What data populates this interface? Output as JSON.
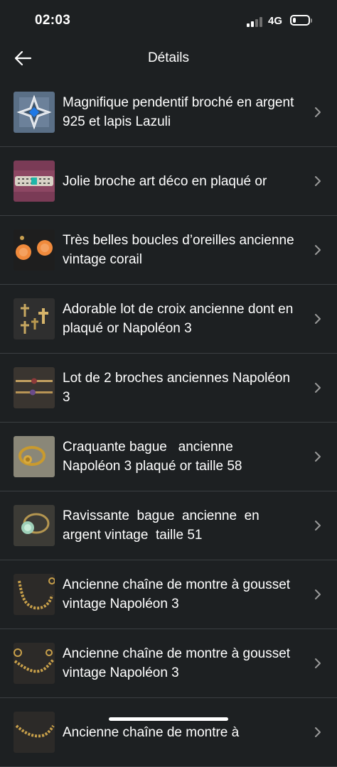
{
  "status": {
    "time": "02:03",
    "network": "4G",
    "battery_level": 0.2
  },
  "header": {
    "title": "Détails",
    "back_icon": "arrow-left-icon"
  },
  "colors": {
    "background": "#1d2022",
    "divider": "#3b3f42",
    "text": "#ffffff",
    "chevron": "#9a9a9a"
  },
  "items": [
    {
      "title": "Magnifique pendentif broché en argent 925 et lapis Lazuli",
      "thumbnail": "pendant-silver-lapis"
    },
    {
      "title": "Jolie broche art déco en plaqué or",
      "thumbnail": "brooch-art-deco"
    },
    {
      "title": "Très belles boucles d’oreilles ancienne vintage corail",
      "thumbnail": "earrings-coral"
    },
    {
      "title": "Adorable lot de croix ancienne dont en plaqué or Napoléon 3",
      "thumbnail": "crosses-gold"
    },
    {
      "title": "Lot de 2 broches anciennes Napoléon 3",
      "thumbnail": "brooches-bar"
    },
    {
      "title": "Craquante bague   ancienne Napoléon 3 plaqué or taille 58",
      "thumbnail": "ring-gold"
    },
    {
      "title": "Ravissante  bague  ancienne  en argent vintage  taille 51",
      "thumbnail": "ring-silver-stone"
    },
    {
      "title": "Ancienne chaîne de montre à gousset vintage Napoléon 3",
      "thumbnail": "watch-chain-1"
    },
    {
      "title": "Ancienne chaîne de montre à gousset vintage Napoléon 3",
      "thumbnail": "watch-chain-2"
    },
    {
      "title": "Ancienne chaîne de montre à",
      "thumbnail": "watch-chain-3"
    }
  ]
}
